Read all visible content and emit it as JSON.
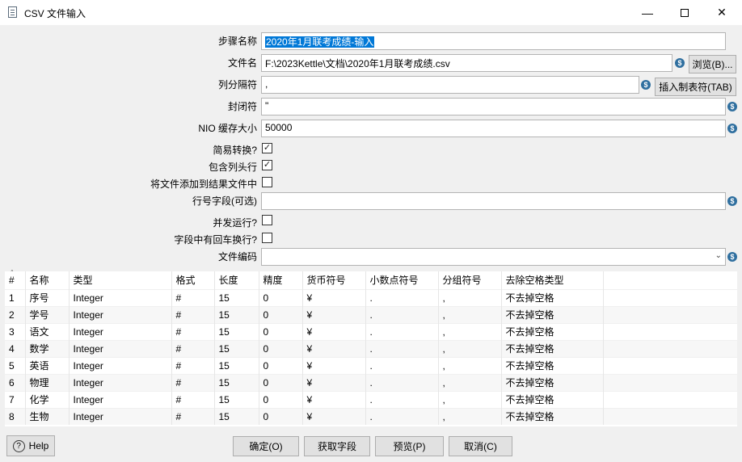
{
  "window": {
    "title": "CSV 文件输入"
  },
  "form": {
    "step_name_label": "步骤名称",
    "step_name_value": "2020年1月联考成绩-输入",
    "filename_label": "文件名",
    "filename_value": "F:\\2023Kettle\\文档\\2020年1月联考成绩.csv",
    "browse_label": "浏览(B)...",
    "delimiter_label": "列分隔符",
    "delimiter_value": ",",
    "insert_tab_label": "插入制表符(TAB)",
    "enclosure_label": "封闭符",
    "enclosure_value": "\"",
    "nio_label": "NIO 缓存大小",
    "nio_value": "50000",
    "lazy_label": "简易转换?",
    "lazy_checked": "✓",
    "header_label": "包含列头行",
    "header_checked": "✓",
    "add_result_label": "将文件添加到结果文件中",
    "add_result_checked": "",
    "rownum_label": "行号字段(可选)",
    "rownum_value": "",
    "parallel_label": "并发运行?",
    "parallel_checked": "",
    "newline_label": "字段中有回车换行?",
    "newline_checked": "",
    "encoding_label": "文件编码",
    "encoding_value": ""
  },
  "table": {
    "columns": [
      "#",
      "名称",
      "类型",
      "格式",
      "长度",
      "精度",
      "货币符号",
      "小数点符号",
      "分组符号",
      "去除空格类型"
    ],
    "rows": [
      [
        "1",
        "序号",
        "Integer",
        "#",
        "15",
        "0",
        "¥",
        ".",
        ",",
        "不去掉空格"
      ],
      [
        "2",
        "学号",
        "Integer",
        "#",
        "15",
        "0",
        "¥",
        ".",
        ",",
        "不去掉空格"
      ],
      [
        "3",
        "语文",
        "Integer",
        "#",
        "15",
        "0",
        "¥",
        ".",
        ",",
        "不去掉空格"
      ],
      [
        "4",
        "数学",
        "Integer",
        "#",
        "15",
        "0",
        "¥",
        ".",
        ",",
        "不去掉空格"
      ],
      [
        "5",
        "英语",
        "Integer",
        "#",
        "15",
        "0",
        "¥",
        ".",
        ",",
        "不去掉空格"
      ],
      [
        "6",
        "物理",
        "Integer",
        "#",
        "15",
        "0",
        "¥",
        ".",
        ",",
        "不去掉空格"
      ],
      [
        "7",
        "化学",
        "Integer",
        "#",
        "15",
        "0",
        "¥",
        ".",
        ",",
        "不去掉空格"
      ],
      [
        "8",
        "生物",
        "Integer",
        "#",
        "15",
        "0",
        "¥",
        ".",
        ",",
        "不去掉空格"
      ]
    ]
  },
  "footer": {
    "help_label": "Help",
    "ok_label": "确定(O)",
    "get_fields_label": "获取字段",
    "preview_label": "预览(P)",
    "cancel_label": "取消(C)"
  },
  "icons": {
    "variable": "variable-icon",
    "help": "help-icon",
    "minimize": "minimize-icon",
    "maximize": "maximize-icon",
    "close": "close-icon"
  }
}
